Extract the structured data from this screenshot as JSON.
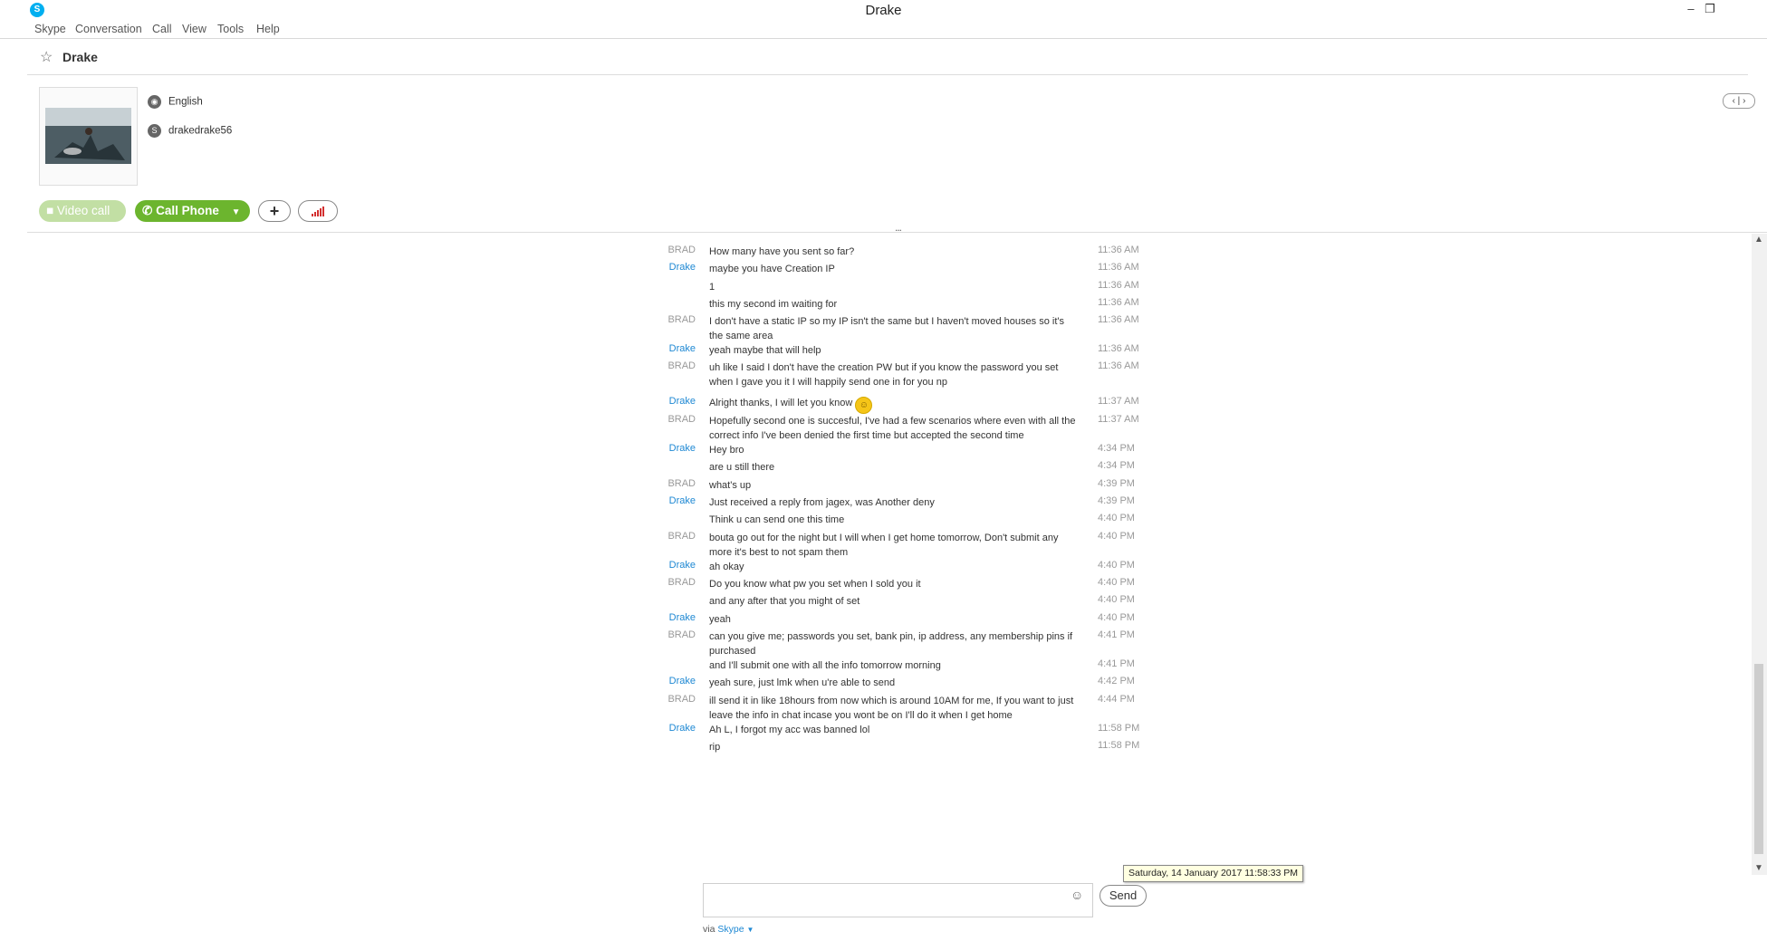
{
  "window": {
    "title": "Drake",
    "app_icon": "skype-logo-icon",
    "minimize": "–",
    "restore": "❐"
  },
  "menu": [
    "Skype",
    "Conversation",
    "Call",
    "View",
    "Tools",
    "Help"
  ],
  "contact": {
    "name": "Drake",
    "language": "English",
    "skype_name": "drakedrake56"
  },
  "actions": {
    "video_call": "Video call",
    "call_phone": "Call Phone",
    "add": "+"
  },
  "messages": [
    {
      "sender": "BRAD",
      "text": "How many have you sent so far?",
      "time": "11:36 AM"
    },
    {
      "sender": "Drake",
      "text": "maybe you have Creation IP",
      "time": "11:36 AM"
    },
    {
      "sender": "",
      "text": "1",
      "time": "11:36 AM"
    },
    {
      "sender": "",
      "text": "this my second im waiting for",
      "time": "11:36 AM"
    },
    {
      "sender": "BRAD",
      "text": "I don't have a static IP so my IP isn't the same but I haven't moved houses so it's the same area",
      "time": "11:36 AM"
    },
    {
      "sender": "Drake",
      "text": "yeah maybe that will help",
      "time": "11:36 AM"
    },
    {
      "sender": "BRAD",
      "text": "uh like I said I don't have the creation PW but if you know the password you set when I gave you it I will happily send one in for you np",
      "time": "11:36 AM"
    },
    {
      "sender": "Drake",
      "text": "Alright thanks, I will let you know",
      "time": "11:37 AM",
      "emoticon": "smile-emoticon"
    },
    {
      "sender": "BRAD",
      "text": "Hopefully second one is succesful, I've had a few scenarios where even with all the correct info I've been denied the first time but accepted the second time",
      "time": "11:37 AM"
    },
    {
      "sender": "Drake",
      "text": "Hey bro",
      "time": "4:34 PM"
    },
    {
      "sender": "",
      "text": "are u still there",
      "time": "4:34 PM"
    },
    {
      "sender": "BRAD",
      "text": "what's up",
      "time": "4:39 PM"
    },
    {
      "sender": "Drake",
      "text": "Just received a reply from jagex, was Another deny",
      "time": "4:39 PM"
    },
    {
      "sender": "",
      "text": "Think u can send one this time",
      "time": "4:40 PM"
    },
    {
      "sender": "BRAD",
      "text": "bouta go out for the night but I will when I get home tomorrow, Don't submit any more it's best to not spam them",
      "time": "4:40 PM"
    },
    {
      "sender": "Drake",
      "text": "ah okay",
      "time": "4:40 PM"
    },
    {
      "sender": "BRAD",
      "text": "Do you know what pw you set when I sold you it",
      "time": "4:40 PM"
    },
    {
      "sender": "",
      "text": "and any after that you might of set",
      "time": "4:40 PM"
    },
    {
      "sender": "Drake",
      "text": "yeah",
      "time": "4:40 PM"
    },
    {
      "sender": "BRAD",
      "text": "can you give me; passwords you set, bank pin, ip address, any membership pins if purchased",
      "time": "4:41 PM"
    },
    {
      "sender": "",
      "text": "and I'll submit one with all the info tomorrow morning",
      "time": "4:41 PM"
    },
    {
      "sender": "Drake",
      "text": "yeah sure, just lmk when u're able to send",
      "time": "4:42 PM"
    },
    {
      "sender": "BRAD",
      "text": "ill send it in like 18hours from now which is around 10AM for me, If you want to just leave the info in chat incase you wont be on I'll do it when I get home",
      "time": "4:44 PM"
    },
    {
      "sender": "Drake",
      "text": "Ah L, I forgot my acc was banned lol",
      "time": "11:58 PM"
    },
    {
      "sender": "",
      "text": "rip",
      "time": "11:58 PM"
    }
  ],
  "tooltip": "Saturday, 14 January 2017 11:58:33 PM",
  "composer": {
    "send_label": "Send",
    "via_prefix": "via",
    "via_service": "Skype"
  },
  "colors": {
    "brand": "#00aff0",
    "call_green": "#6cb52e",
    "drake_name": "#1e88d3",
    "brad_name": "#999999"
  }
}
